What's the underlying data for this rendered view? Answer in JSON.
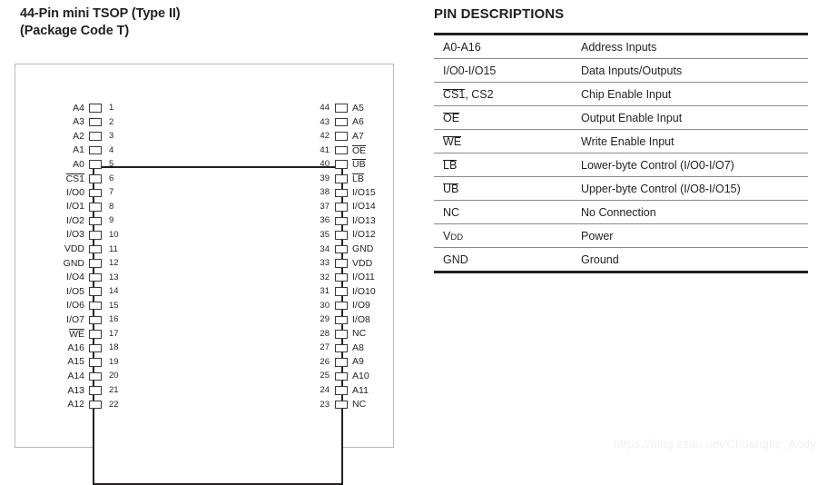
{
  "package": {
    "title_line1": "44-Pin mini TSOP (Type II)",
    "title_line2": "(Package Code T)",
    "left_pins": [
      {
        "num": "1",
        "label": "A4",
        "overbar": false
      },
      {
        "num": "2",
        "label": "A3",
        "overbar": false
      },
      {
        "num": "3",
        "label": "A2",
        "overbar": false
      },
      {
        "num": "4",
        "label": "A1",
        "overbar": false
      },
      {
        "num": "5",
        "label": "A0",
        "overbar": false
      },
      {
        "num": "6",
        "label": "CS1",
        "overbar": true
      },
      {
        "num": "7",
        "label": "I/O0",
        "overbar": false
      },
      {
        "num": "8",
        "label": "I/O1",
        "overbar": false
      },
      {
        "num": "9",
        "label": "I/O2",
        "overbar": false
      },
      {
        "num": "10",
        "label": "I/O3",
        "overbar": false
      },
      {
        "num": "11",
        "label": "VDD",
        "overbar": false
      },
      {
        "num": "12",
        "label": "GND",
        "overbar": false
      },
      {
        "num": "13",
        "label": "I/O4",
        "overbar": false
      },
      {
        "num": "14",
        "label": "I/O5",
        "overbar": false
      },
      {
        "num": "15",
        "label": "I/O6",
        "overbar": false
      },
      {
        "num": "16",
        "label": "I/O7",
        "overbar": false
      },
      {
        "num": "17",
        "label": "WE",
        "overbar": true
      },
      {
        "num": "18",
        "label": "A16",
        "overbar": false
      },
      {
        "num": "19",
        "label": "A15",
        "overbar": false
      },
      {
        "num": "20",
        "label": "A14",
        "overbar": false
      },
      {
        "num": "21",
        "label": "A13",
        "overbar": false
      },
      {
        "num": "22",
        "label": "A12",
        "overbar": false
      }
    ],
    "right_pins": [
      {
        "num": "44",
        "label": "A5",
        "overbar": false
      },
      {
        "num": "43",
        "label": "A6",
        "overbar": false
      },
      {
        "num": "42",
        "label": "A7",
        "overbar": false
      },
      {
        "num": "41",
        "label": "OE",
        "overbar": true
      },
      {
        "num": "40",
        "label": "UB",
        "overbar": true
      },
      {
        "num": "39",
        "label": "LB",
        "overbar": true
      },
      {
        "num": "38",
        "label": "I/O15",
        "overbar": false
      },
      {
        "num": "37",
        "label": "I/O14",
        "overbar": false
      },
      {
        "num": "36",
        "label": "I/O13",
        "overbar": false
      },
      {
        "num": "35",
        "label": "I/O12",
        "overbar": false
      },
      {
        "num": "34",
        "label": "GND",
        "overbar": false
      },
      {
        "num": "33",
        "label": "VDD",
        "overbar": false
      },
      {
        "num": "32",
        "label": "I/O11",
        "overbar": false
      },
      {
        "num": "31",
        "label": "I/O10",
        "overbar": false
      },
      {
        "num": "30",
        "label": "I/O9",
        "overbar": false
      },
      {
        "num": "29",
        "label": "I/O8",
        "overbar": false
      },
      {
        "num": "28",
        "label": "NC",
        "overbar": false
      },
      {
        "num": "27",
        "label": "A8",
        "overbar": false
      },
      {
        "num": "26",
        "label": "A9",
        "overbar": false
      },
      {
        "num": "25",
        "label": "A10",
        "overbar": false
      },
      {
        "num": "24",
        "label": "A11",
        "overbar": false
      },
      {
        "num": "23",
        "label": "NC",
        "overbar": false
      }
    ]
  },
  "descriptions": {
    "title": "PIN DESCRIPTIONS",
    "rows": [
      {
        "signal": "A0-A16",
        "overbar": "none",
        "description": "Address Inputs"
      },
      {
        "signal": "I/O0-I/O15",
        "overbar": "none",
        "description": "Data Inputs/Outputs"
      },
      {
        "signal": "CS1, CS2",
        "overbar": "cs1",
        "description": "Chip Enable Input"
      },
      {
        "signal": "OE",
        "overbar": "full",
        "description": "Output Enable Input"
      },
      {
        "signal": "WE",
        "overbar": "full",
        "description": "Write Enable Input"
      },
      {
        "signal": "LB",
        "overbar": "full",
        "description": "Lower-byte Control (I/O0-I/O7)"
      },
      {
        "signal": "UB",
        "overbar": "full",
        "description": "Upper-byte Control (I/O8-I/O15)"
      },
      {
        "signal": "NC",
        "overbar": "none",
        "description": "No Connection"
      },
      {
        "signal": "VDD",
        "overbar": "vdd",
        "description": "Power"
      },
      {
        "signal": "GND",
        "overbar": "none",
        "description": "Ground"
      }
    ]
  },
  "watermark": {
    "text": "https://blog.csdn.net/Chuangke_Andy"
  },
  "colors": {
    "ink": "#231f20",
    "rule": "#8a8a8a",
    "frame": "#b9b9b9",
    "watermark": "#f0f0f0"
  }
}
